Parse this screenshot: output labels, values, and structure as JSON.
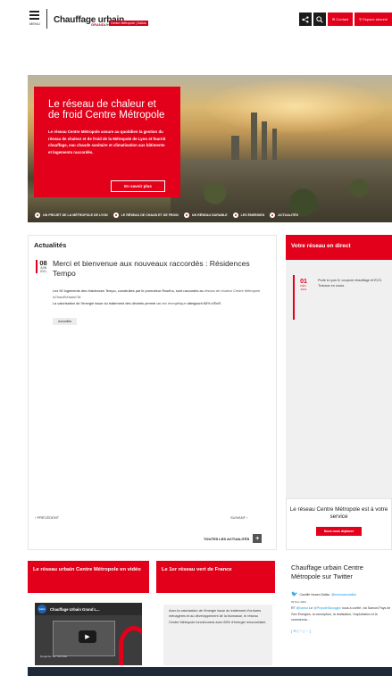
{
  "header": {
    "menu_label": "MENU",
    "logo_main": "Chauffage urbain",
    "logo_grand": "GRAND",
    "logo_lyon": "LYON",
    "logo_tag": "Centre Métropole",
    "logo_badge": "Dalkia",
    "share_icon": "share-icon",
    "search_icon": "search-icon",
    "contact_label": "✉ Contact",
    "space_label": "⚲ Espace abonné"
  },
  "hero": {
    "title": "Le réseau de chaleur et de froid Centre Métropole",
    "text": "Le réseau Centre Métropole assure au quotidien la gestion du réseau de chaleur et de froid de la Métropole de Lyon et fournit chauffage, eau chaude sanitaire et climatisation aux bâtiments et logements raccordés.",
    "button": "En savoir plus",
    "links": [
      "UN PROJET DE LA MÉTROPOLE DE LYON",
      "LE RÉSEAU DE CHAUD ET DE FROID",
      "UN RÉSEAU DURABLE",
      "LES ÉNERGIES",
      "ACTUALITÉS"
    ]
  },
  "news": {
    "title": "Actualités",
    "article": {
      "day": "08",
      "month": "JUIN",
      "year": "2021",
      "title": "Merci et bienvenue aux nouveaux raccordés : Résidences Tempo",
      "body_1": "Les 90 logements des résidences Tempo, construites par le promoteur Rosého, sont raccordés au ",
      "body_em": "réseau de chaleur Centre Métropole #ChauffUrbainCM.",
      "body_2": "La valorisation de l'énergie issue du traitement des déchets permet un ",
      "body_em2": "mix énergétique",
      "body_3": " atteignant 65% d'EnR.",
      "tag": "Actualités"
    },
    "prev": "‹  PRÉCÉDENT",
    "next": "SUIVANT  ›",
    "all": "TOUTES LES ACTUALITÉS",
    "all_btn": "+"
  },
  "live": {
    "title": "Votre réseau en direct",
    "item": {
      "day": "01",
      "month": "DÉC.",
      "year": "2021",
      "text": "Purle à Lyon 8, coupure chauffage et ECS. Travaux en cours."
    },
    "box_title": "Le réseau Centre Métropole est à votre service",
    "box_button": "Nous nous déplacer"
  },
  "cards": {
    "video": {
      "title": "Le réseau urbain Centre Métropole en vidéo",
      "avatar": "dalkia",
      "video_title": "Chauffage Urbain Grand L...",
      "watch": "Regarder sur YouTube"
    },
    "green": {
      "title": "Le 1er réseau vert de France",
      "text": "Avec la valorisation de l'énergie issue du traitement d'ordures ménagères et au développement de la biomasse, le réseau Centre Métropole fonctionnera avec 65% d'énergie renouvelable."
    },
    "twitter": {
      "title": "Chauffage urbain Centre Métropole sur Twitter",
      "author": "Carnifle Huwen Dalkia",
      "handle": "@lemhuwendalkia",
      "date": "03 Nov 2021",
      "text_1": "RT ",
      "mention_1": "@banlut",
      "text_2": " Le ",
      "mention_2": "@PeysdeSavoggin",
      "text_3": " nous a confié, via Samoé-Pays de Gex Énergies, la conception, la réalisation, l'exploitation et la commercia...",
      "actions": "[ ⟲ | ♡ | ⋯ ]"
    }
  }
}
